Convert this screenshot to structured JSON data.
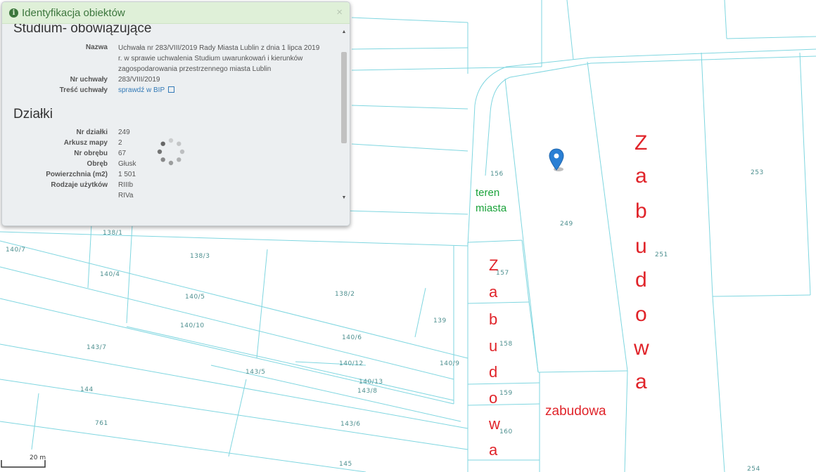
{
  "panel": {
    "title": "Identyfikacja obiektów",
    "close": "×",
    "study": {
      "heading": "Studium- obowiązujące",
      "rows": [
        {
          "label": "Nazwa",
          "value": "Uchwała nr 283/VIII/2019 Rady Miasta Lublin z dnia 1 lipca 2019 r. w sprawie uchwalenia Studium uwarunkowań i kierunków zagospodarowania przestrzennego miasta Lublin"
        },
        {
          "label": "Nr uchwały",
          "value": "283/VIII/2019"
        },
        {
          "label": "Treść uchwały",
          "value": "sprawdź w BIP"
        }
      ]
    },
    "parcels": {
      "heading": "Działki",
      "rows": [
        {
          "label": "Nr działki",
          "value": "249"
        },
        {
          "label": "Arkusz mapy",
          "value": "2"
        },
        {
          "label": "Nr obrębu",
          "value": "67"
        },
        {
          "label": "Obręb",
          "value": "Głusk"
        },
        {
          "label": "Powierzchnia (m2)",
          "value": "1 501"
        },
        {
          "label": "Rodzaje użytków",
          "value": "RIIIb"
        }
      ],
      "extra_value": "RIVa"
    }
  },
  "map": {
    "parcel_labels": [
      "138/1",
      "140/7",
      "138/3",
      "140/4",
      "140/5",
      "138/2",
      "139",
      "140/10",
      "140/6",
      "143/7",
      "140/12",
      "140/9",
      "143/5",
      "140/13",
      "143/8",
      "144",
      "761",
      "143/6",
      "145",
      "156",
      "249",
      "251",
      "253",
      "157",
      "158",
      "159",
      "160",
      "254"
    ],
    "annotations": {
      "green": [
        "teren",
        "miasta"
      ],
      "red_vertical_left": [
        "Z",
        "a",
        "b",
        "u",
        "d",
        "o",
        "w",
        "a"
      ],
      "red_vertical_right": [
        "Z",
        "a",
        "b",
        "u",
        "d",
        "o",
        "w",
        "a"
      ],
      "red_horizontal": "zabudowa"
    },
    "scale_label": "20 m",
    "colors": {
      "boundary": "#7fd6e0",
      "parcel_text": "#4d8f8f",
      "green_annot": "#1aa33a",
      "red_annot": "#e0242a",
      "marker": "#2a7fd4"
    }
  }
}
